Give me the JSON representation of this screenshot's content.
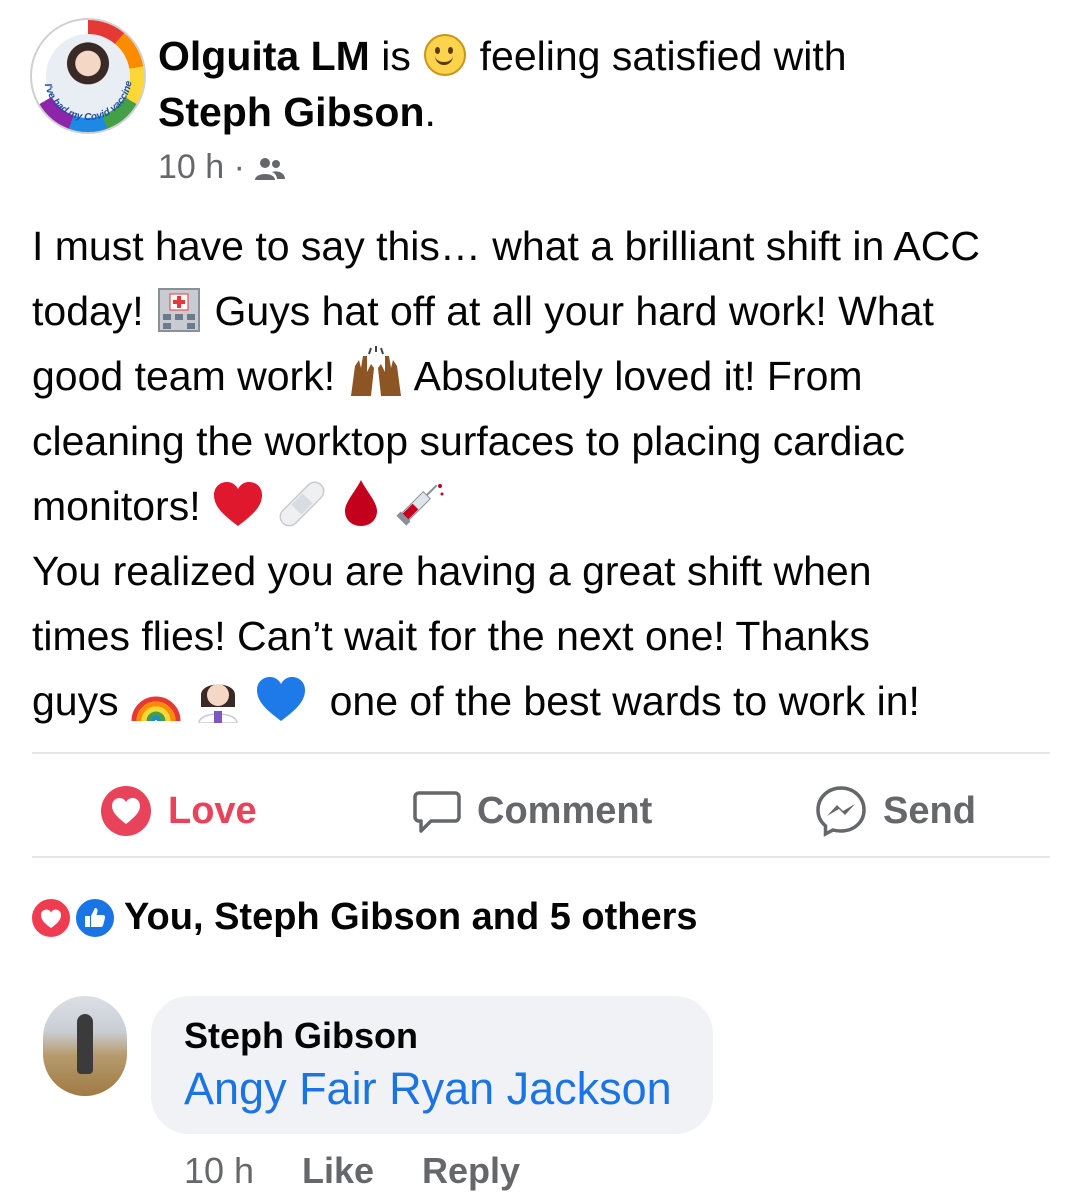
{
  "post": {
    "author": "Olguita LM",
    "connector": "is",
    "feeling_text": "feeling satisfied with",
    "tagged": "Steph Gibson",
    "tagged_suffix": ".",
    "time": "10 h",
    "meta_separator": "·",
    "privacy_icon": "friends-icon",
    "avatar_frame_text": "I've had my Covid vaccine",
    "lines": {
      "l1": "I must have to say this… what a brilliant shift in ACC",
      "l2a": "today!",
      "l2b": "Guys hat off at all your hard work! What",
      "l3a": "good team work!",
      "l3b": "Absolutely loved it! From",
      "l4": "cleaning the worktop surfaces to placing cardiac",
      "l5": "monitors!",
      "l6": "You realized you are having a great shift when",
      "l7": "times flies! Can’t wait for the next one! Thanks",
      "l8a": "guys",
      "l8b": "one of the best wards to work in!"
    },
    "emojis": [
      "hospital",
      "raising-hands",
      "red-heart",
      "bandage",
      "drop-of-blood",
      "syringe",
      "rainbow",
      "woman-health-worker",
      "blue-heart"
    ]
  },
  "actions": {
    "love": "Love",
    "comment": "Comment",
    "send": "Send",
    "love_color": "#e8435a"
  },
  "reactions": {
    "summary": "You, Steph Gibson and 5 others",
    "types": [
      "love",
      "like"
    ]
  },
  "comment": {
    "author": "Steph Gibson",
    "text": "Angy Fair Ryan Jackson",
    "time": "10 h",
    "like": "Like",
    "reply": "Reply",
    "mention_color": "#1b74e4"
  }
}
